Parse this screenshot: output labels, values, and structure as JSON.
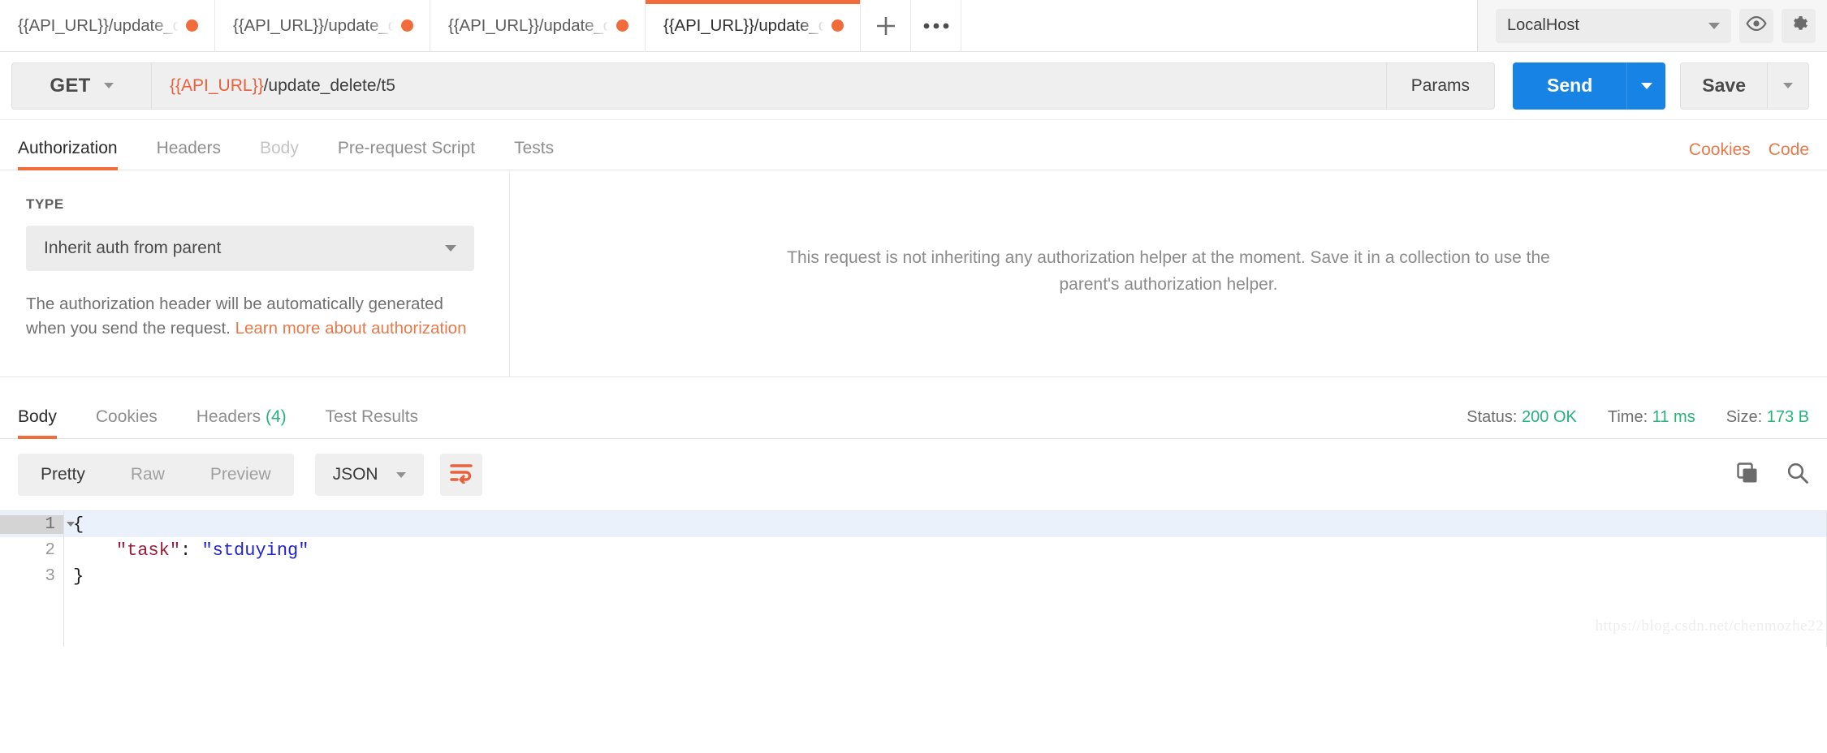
{
  "tabbar": {
    "tabs": [
      {
        "label": "{{API_URL}}/update_d",
        "unsaved": true,
        "active": false
      },
      {
        "label": "{{API_URL}}/update_d",
        "unsaved": true,
        "active": false
      },
      {
        "label": "{{API_URL}}/update_d",
        "unsaved": true,
        "active": false
      },
      {
        "label": "{{API_URL}}/update_d",
        "unsaved": true,
        "active": true
      }
    ],
    "new_tab_icon": "plus-icon",
    "more_icon": "ellipsis-icon",
    "environment": "LocalHost",
    "eye_icon": "eye-icon",
    "settings_icon": "gear-icon"
  },
  "request": {
    "method": "GET",
    "url_variable": "{{API_URL}}",
    "url_path": "/update_delete/t5",
    "params_label": "Params",
    "send_label": "Send",
    "save_label": "Save"
  },
  "request_tabs": [
    {
      "label": "Authorization",
      "active": true,
      "dim": false
    },
    {
      "label": "Headers",
      "active": false,
      "dim": false
    },
    {
      "label": "Body",
      "active": false,
      "dim": true
    },
    {
      "label": "Pre-request Script",
      "active": false,
      "dim": false
    },
    {
      "label": "Tests",
      "active": false,
      "dim": false
    }
  ],
  "request_links": [
    {
      "label": "Cookies"
    },
    {
      "label": "Code"
    }
  ],
  "authorization": {
    "type_label": "TYPE",
    "type_value": "Inherit auth from parent",
    "note_text": "The authorization header will be automatically generated when you send the request. ",
    "note_link": "Learn more about authorization",
    "center_message": "This request is not inheriting any authorization helper at the moment. Save it in a collection to use the parent's authorization helper."
  },
  "response": {
    "tabs": [
      {
        "label": "Body",
        "count": "",
        "active": true
      },
      {
        "label": "Cookies",
        "count": "",
        "active": false
      },
      {
        "label": "Headers",
        "count": "(4)",
        "active": false
      },
      {
        "label": "Test Results",
        "count": "",
        "active": false
      }
    ],
    "status_label": "Status:",
    "status_value": "200 OK",
    "time_label": "Time:",
    "time_value": "11 ms",
    "size_label": "Size:",
    "size_value": "173 B",
    "view_modes": [
      {
        "label": "Pretty",
        "active": true
      },
      {
        "label": "Raw",
        "active": false
      },
      {
        "label": "Preview",
        "active": false
      }
    ],
    "format": "JSON",
    "wrap_icon": "word-wrap-icon",
    "copy_icon": "copy-icon",
    "search_icon": "search-icon",
    "body_lines": [
      {
        "num": "1",
        "foldable": true,
        "highlight": true,
        "segments": [
          {
            "text": "{",
            "type": "punc"
          }
        ]
      },
      {
        "num": "2",
        "foldable": false,
        "highlight": false,
        "segments": [
          {
            "text": "    ",
            "type": "punc"
          },
          {
            "text": "\"task\"",
            "type": "key"
          },
          {
            "text": ": ",
            "type": "punc"
          },
          {
            "text": "\"stduying\"",
            "type": "str"
          }
        ]
      },
      {
        "num": "3",
        "foldable": false,
        "highlight": false,
        "segments": [
          {
            "text": "}",
            "type": "punc"
          }
        ]
      }
    ]
  },
  "watermark": "https://blog.csdn.net/chenmozhe22",
  "colors": {
    "accent_orange": "#f26b3a",
    "send_blue": "#1784e5",
    "status_green": "#26b37a",
    "variable_red": "#e8603c"
  }
}
